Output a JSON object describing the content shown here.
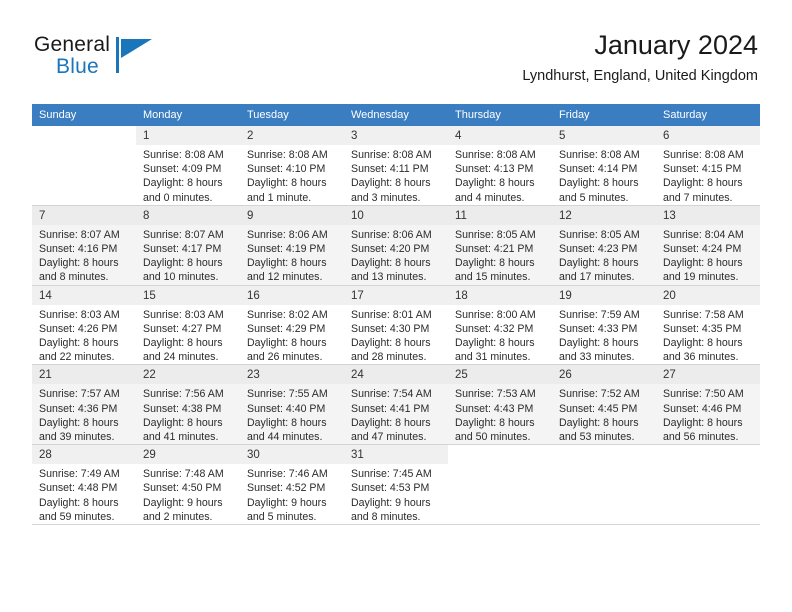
{
  "brand": {
    "name_part1": "General",
    "name_part2": "Blue",
    "logo_icon": "triangle-flag-icon",
    "accent_color": "#1b75bb"
  },
  "header": {
    "title": "January 2024",
    "subtitle": "Lyndhurst, England, United Kingdom"
  },
  "calendar": {
    "header_bg": "#3a7dc0",
    "weekdays": [
      "Sunday",
      "Monday",
      "Tuesday",
      "Wednesday",
      "Thursday",
      "Friday",
      "Saturday"
    ],
    "weeks": [
      {
        "shaded": false,
        "days": [
          {
            "num": "",
            "sunrise": "",
            "sunset": "",
            "daylight_line1": "",
            "daylight_line2": "",
            "empty": true
          },
          {
            "num": "1",
            "sunrise": "Sunrise: 8:08 AM",
            "sunset": "Sunset: 4:09 PM",
            "daylight_line1": "Daylight: 8 hours",
            "daylight_line2": "and 0 minutes."
          },
          {
            "num": "2",
            "sunrise": "Sunrise: 8:08 AM",
            "sunset": "Sunset: 4:10 PM",
            "daylight_line1": "Daylight: 8 hours",
            "daylight_line2": "and 1 minute."
          },
          {
            "num": "3",
            "sunrise": "Sunrise: 8:08 AM",
            "sunset": "Sunset: 4:11 PM",
            "daylight_line1": "Daylight: 8 hours",
            "daylight_line2": "and 3 minutes."
          },
          {
            "num": "4",
            "sunrise": "Sunrise: 8:08 AM",
            "sunset": "Sunset: 4:13 PM",
            "daylight_line1": "Daylight: 8 hours",
            "daylight_line2": "and 4 minutes."
          },
          {
            "num": "5",
            "sunrise": "Sunrise: 8:08 AM",
            "sunset": "Sunset: 4:14 PM",
            "daylight_line1": "Daylight: 8 hours",
            "daylight_line2": "and 5 minutes."
          },
          {
            "num": "6",
            "sunrise": "Sunrise: 8:08 AM",
            "sunset": "Sunset: 4:15 PM",
            "daylight_line1": "Daylight: 8 hours",
            "daylight_line2": "and 7 minutes."
          }
        ]
      },
      {
        "shaded": true,
        "days": [
          {
            "num": "7",
            "sunrise": "Sunrise: 8:07 AM",
            "sunset": "Sunset: 4:16 PM",
            "daylight_line1": "Daylight: 8 hours",
            "daylight_line2": "and 8 minutes."
          },
          {
            "num": "8",
            "sunrise": "Sunrise: 8:07 AM",
            "sunset": "Sunset: 4:17 PM",
            "daylight_line1": "Daylight: 8 hours",
            "daylight_line2": "and 10 minutes."
          },
          {
            "num": "9",
            "sunrise": "Sunrise: 8:06 AM",
            "sunset": "Sunset: 4:19 PM",
            "daylight_line1": "Daylight: 8 hours",
            "daylight_line2": "and 12 minutes."
          },
          {
            "num": "10",
            "sunrise": "Sunrise: 8:06 AM",
            "sunset": "Sunset: 4:20 PM",
            "daylight_line1": "Daylight: 8 hours",
            "daylight_line2": "and 13 minutes."
          },
          {
            "num": "11",
            "sunrise": "Sunrise: 8:05 AM",
            "sunset": "Sunset: 4:21 PM",
            "daylight_line1": "Daylight: 8 hours",
            "daylight_line2": "and 15 minutes."
          },
          {
            "num": "12",
            "sunrise": "Sunrise: 8:05 AM",
            "sunset": "Sunset: 4:23 PM",
            "daylight_line1": "Daylight: 8 hours",
            "daylight_line2": "and 17 minutes."
          },
          {
            "num": "13",
            "sunrise": "Sunrise: 8:04 AM",
            "sunset": "Sunset: 4:24 PM",
            "daylight_line1": "Daylight: 8 hours",
            "daylight_line2": "and 19 minutes."
          }
        ]
      },
      {
        "shaded": false,
        "days": [
          {
            "num": "14",
            "sunrise": "Sunrise: 8:03 AM",
            "sunset": "Sunset: 4:26 PM",
            "daylight_line1": "Daylight: 8 hours",
            "daylight_line2": "and 22 minutes."
          },
          {
            "num": "15",
            "sunrise": "Sunrise: 8:03 AM",
            "sunset": "Sunset: 4:27 PM",
            "daylight_line1": "Daylight: 8 hours",
            "daylight_line2": "and 24 minutes."
          },
          {
            "num": "16",
            "sunrise": "Sunrise: 8:02 AM",
            "sunset": "Sunset: 4:29 PM",
            "daylight_line1": "Daylight: 8 hours",
            "daylight_line2": "and 26 minutes."
          },
          {
            "num": "17",
            "sunrise": "Sunrise: 8:01 AM",
            "sunset": "Sunset: 4:30 PM",
            "daylight_line1": "Daylight: 8 hours",
            "daylight_line2": "and 28 minutes."
          },
          {
            "num": "18",
            "sunrise": "Sunrise: 8:00 AM",
            "sunset": "Sunset: 4:32 PM",
            "daylight_line1": "Daylight: 8 hours",
            "daylight_line2": "and 31 minutes."
          },
          {
            "num": "19",
            "sunrise": "Sunrise: 7:59 AM",
            "sunset": "Sunset: 4:33 PM",
            "daylight_line1": "Daylight: 8 hours",
            "daylight_line2": "and 33 minutes."
          },
          {
            "num": "20",
            "sunrise": "Sunrise: 7:58 AM",
            "sunset": "Sunset: 4:35 PM",
            "daylight_line1": "Daylight: 8 hours",
            "daylight_line2": "and 36 minutes."
          }
        ]
      },
      {
        "shaded": true,
        "days": [
          {
            "num": "21",
            "sunrise": "Sunrise: 7:57 AM",
            "sunset": "Sunset: 4:36 PM",
            "daylight_line1": "Daylight: 8 hours",
            "daylight_line2": "and 39 minutes."
          },
          {
            "num": "22",
            "sunrise": "Sunrise: 7:56 AM",
            "sunset": "Sunset: 4:38 PM",
            "daylight_line1": "Daylight: 8 hours",
            "daylight_line2": "and 41 minutes."
          },
          {
            "num": "23",
            "sunrise": "Sunrise: 7:55 AM",
            "sunset": "Sunset: 4:40 PM",
            "daylight_line1": "Daylight: 8 hours",
            "daylight_line2": "and 44 minutes."
          },
          {
            "num": "24",
            "sunrise": "Sunrise: 7:54 AM",
            "sunset": "Sunset: 4:41 PM",
            "daylight_line1": "Daylight: 8 hours",
            "daylight_line2": "and 47 minutes."
          },
          {
            "num": "25",
            "sunrise": "Sunrise: 7:53 AM",
            "sunset": "Sunset: 4:43 PM",
            "daylight_line1": "Daylight: 8 hours",
            "daylight_line2": "and 50 minutes."
          },
          {
            "num": "26",
            "sunrise": "Sunrise: 7:52 AM",
            "sunset": "Sunset: 4:45 PM",
            "daylight_line1": "Daylight: 8 hours",
            "daylight_line2": "and 53 minutes."
          },
          {
            "num": "27",
            "sunrise": "Sunrise: 7:50 AM",
            "sunset": "Sunset: 4:46 PM",
            "daylight_line1": "Daylight: 8 hours",
            "daylight_line2": "and 56 minutes."
          }
        ]
      },
      {
        "shaded": false,
        "days": [
          {
            "num": "28",
            "sunrise": "Sunrise: 7:49 AM",
            "sunset": "Sunset: 4:48 PM",
            "daylight_line1": "Daylight: 8 hours",
            "daylight_line2": "and 59 minutes."
          },
          {
            "num": "29",
            "sunrise": "Sunrise: 7:48 AM",
            "sunset": "Sunset: 4:50 PM",
            "daylight_line1": "Daylight: 9 hours",
            "daylight_line2": "and 2 minutes."
          },
          {
            "num": "30",
            "sunrise": "Sunrise: 7:46 AM",
            "sunset": "Sunset: 4:52 PM",
            "daylight_line1": "Daylight: 9 hours",
            "daylight_line2": "and 5 minutes."
          },
          {
            "num": "31",
            "sunrise": "Sunrise: 7:45 AM",
            "sunset": "Sunset: 4:53 PM",
            "daylight_line1": "Daylight: 9 hours",
            "daylight_line2": "and 8 minutes."
          },
          {
            "num": "",
            "sunrise": "",
            "sunset": "",
            "daylight_line1": "",
            "daylight_line2": "",
            "empty": true
          },
          {
            "num": "",
            "sunrise": "",
            "sunset": "",
            "daylight_line1": "",
            "daylight_line2": "",
            "empty": true
          },
          {
            "num": "",
            "sunrise": "",
            "sunset": "",
            "daylight_line1": "",
            "daylight_line2": "",
            "empty": true
          }
        ]
      }
    ]
  }
}
